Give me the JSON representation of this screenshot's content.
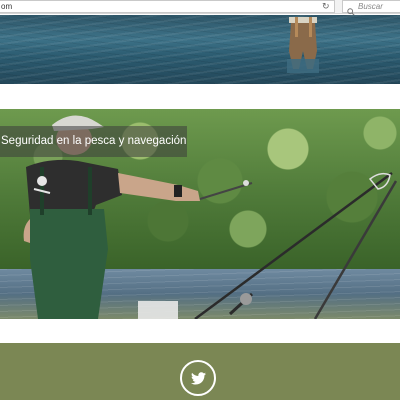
{
  "browser": {
    "url_fragment": "om",
    "reload_icon": "reload-icon",
    "search_placeholder": "Buscar",
    "search_icon": "search-icon"
  },
  "photos": {
    "river_strip": {
      "description_icon": "image"
    },
    "fisherman": {
      "caption": "Seguridad en la pesca y navegación"
    }
  },
  "footer": {
    "background_color": "#7b8754",
    "social_icon": "twitter-icon"
  }
}
